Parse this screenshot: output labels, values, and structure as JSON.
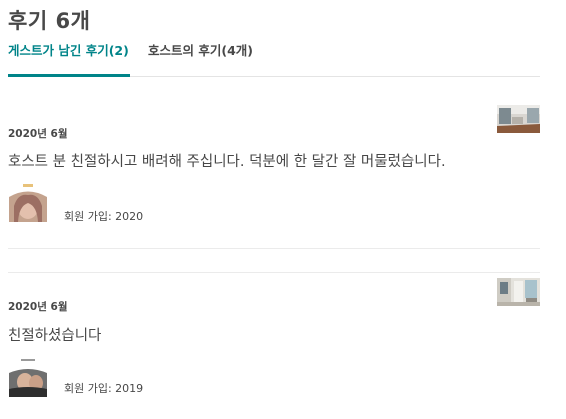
{
  "header": {
    "title": "후기 6개"
  },
  "tabs": [
    {
      "label": "게스트가 남긴 후기(2)"
    },
    {
      "label": "호스트의 후기(4개)"
    }
  ],
  "reviews": [
    {
      "date": "2020년 6월",
      "text": "호스트 분 친절하시고 배려해 주십니다. 덕분에 한 달간 잘 머물렀습니다.",
      "member_since": "회원 가입: 2020"
    },
    {
      "date": "2020년 6월",
      "text": "친절하셨습니다",
      "member_since": "회원 가입: 2019"
    }
  ],
  "colors": {
    "accent": "#008489",
    "text": "#484848",
    "divider": "#ebebeb"
  }
}
